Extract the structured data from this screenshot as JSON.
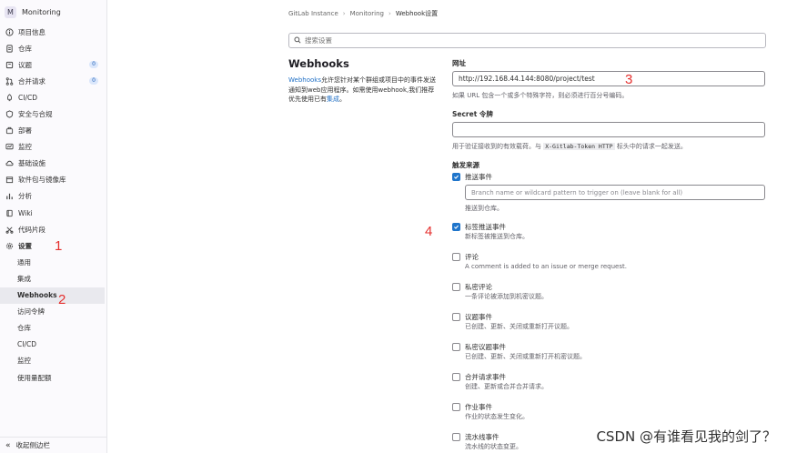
{
  "sidebar": {
    "project_initial": "M",
    "project_name": "Monitoring",
    "items": [
      {
        "label": "项目信息",
        "icon": "info-icon"
      },
      {
        "label": "仓库",
        "icon": "document-icon"
      },
      {
        "label": "议题",
        "icon": "issues-icon",
        "badge": "0"
      },
      {
        "label": "合并请求",
        "icon": "merge-request-icon",
        "badge": "0"
      },
      {
        "label": "CI/CD",
        "icon": "rocket-icon"
      },
      {
        "label": "安全与合规",
        "icon": "shield-icon"
      },
      {
        "label": "部署",
        "icon": "deploy-icon"
      },
      {
        "label": "监控",
        "icon": "monitor-icon"
      },
      {
        "label": "基础设施",
        "icon": "cloud-icon"
      },
      {
        "label": "软件包与镜像库",
        "icon": "package-icon"
      },
      {
        "label": "分析",
        "icon": "chart-icon"
      },
      {
        "label": "Wiki",
        "icon": "book-icon"
      },
      {
        "label": "代码片段",
        "icon": "snippet-icon"
      },
      {
        "label": "设置",
        "icon": "gear-icon"
      }
    ],
    "settings_sub": [
      {
        "label": "通用"
      },
      {
        "label": "集成"
      },
      {
        "label": "Webhooks",
        "active": true
      },
      {
        "label": "访问令牌"
      },
      {
        "label": "仓库"
      },
      {
        "label": "CI/CD"
      },
      {
        "label": "监控"
      },
      {
        "label": "使用量配额"
      }
    ],
    "collapse_label": "收起侧边栏"
  },
  "annotations": {
    "a1": "1",
    "a2": "2",
    "a3": "3",
    "a4": "4"
  },
  "breadcrumb": {
    "items": [
      "GitLab Instance",
      "Monitoring",
      "Webhook设置"
    ]
  },
  "search": {
    "placeholder": "搜索设置"
  },
  "section": {
    "title": "Webhooks",
    "desc_link": "Webhooks",
    "desc_text": "允许您针对某个群组或项目中的事件发送通知到web应用程序。如需使用webhook,我们推荐优先使用已有",
    "desc_link2": "集成",
    "desc_end": "。"
  },
  "form": {
    "url_label": "网址",
    "url_value": "http://192.168.44.144:8080/project/test",
    "url_help": "如果 URL 包含一个或多个特殊字符，则必须进行百分号编码。",
    "secret_label": "Secret 令牌",
    "secret_value": "",
    "secret_help_pre": "用于验证接收到的有效载荷。与",
    "secret_help_code": "X-Gitlab-Token HTTP",
    "secret_help_post": "标头中的请求一起发送。",
    "trigger_label": "触发来源",
    "branch_placeholder": "Branch name or wildcard pattern to trigger on (leave blank for all)",
    "triggers": [
      {
        "name": "推送事件",
        "desc": "推送到仓库。",
        "checked": true
      },
      {
        "name": "标签推送事件",
        "desc": "新标签被推送到仓库。",
        "checked": true
      },
      {
        "name": "评论",
        "desc": "A comment is added to an issue or merge request.",
        "checked": false
      },
      {
        "name": "私密评论",
        "desc": "一条评论被添加到机密议题。",
        "checked": false
      },
      {
        "name": "议题事件",
        "desc": "已创建、更新、关闭或重新打开议题。",
        "checked": false
      },
      {
        "name": "私密议题事件",
        "desc": "已创建、更新、关闭或重新打开机密议题。",
        "checked": false
      },
      {
        "name": "合并请求事件",
        "desc": "创建、更新或合并合并请求。",
        "checked": false
      },
      {
        "name": "作业事件",
        "desc": "作业的状态发生变化。",
        "checked": false
      },
      {
        "name": "流水线事件",
        "desc": "流水线的状态变更。",
        "checked": false
      }
    ]
  },
  "watermark": "CSDN @有谁看见我的剑了？"
}
